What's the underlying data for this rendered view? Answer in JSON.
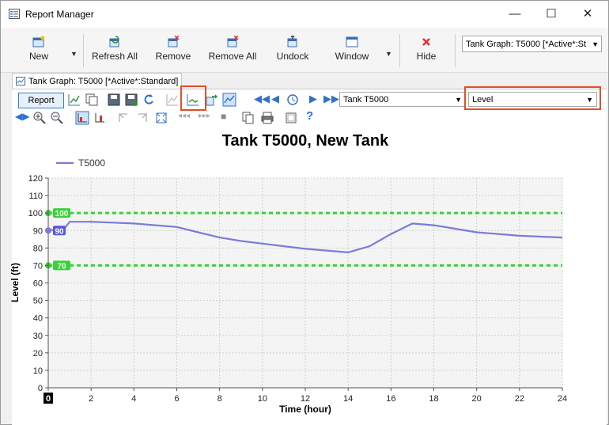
{
  "window": {
    "title": "Report Manager",
    "minimize_glyph": "—",
    "maximize_glyph": "☐",
    "close_glyph": "✕"
  },
  "ribbon": {
    "new": "New",
    "refresh_all": "Refresh All",
    "remove": "Remove",
    "remove_all": "Remove All",
    "undock": "Undock",
    "window": "Window",
    "hide": "Hide",
    "report_selector": "Tank Graph: T5000 [*Active*:St"
  },
  "tab": {
    "label": "Tank Graph: T5000 [*Active*:Standard]"
  },
  "toolbar": {
    "report_label": "Report",
    "element_selector": "Tank T5000",
    "field_selector": "Level",
    "help_glyph": "?"
  },
  "colors": {
    "series": "#7b7bd8",
    "threshold": "#3ad13a",
    "highlight": "#e0502a",
    "accent": "#2f6fd1"
  },
  "chart_data": {
    "type": "line",
    "title": "Tank T5000, New Tank",
    "xlabel": "Time (hour)",
    "ylabel": "Level (ft)",
    "xlim": [
      0,
      24
    ],
    "ylim": [
      0,
      120
    ],
    "xticks": [
      0,
      2,
      4,
      6,
      8,
      10,
      12,
      14,
      16,
      18,
      20,
      22,
      24
    ],
    "yticks": [
      0,
      10,
      20,
      30,
      40,
      50,
      60,
      70,
      80,
      90,
      100,
      110,
      120
    ],
    "grid": true,
    "legend": "top-left",
    "series": [
      {
        "name": "T5000",
        "x": [
          0,
          0.75,
          1,
          2,
          4,
          6,
          7,
          8,
          9,
          10,
          11,
          12,
          13,
          14,
          15,
          16,
          17,
          18,
          19,
          20,
          21,
          22,
          23,
          24
        ],
        "y": [
          90,
          91,
          95,
          95,
          94,
          92,
          89,
          86,
          84,
          82.5,
          81,
          79.5,
          78.5,
          77.5,
          81,
          88,
          94,
          93,
          91,
          89,
          88,
          87,
          86.5,
          86
        ]
      }
    ],
    "thresholds": [
      {
        "value": 100,
        "label": "100"
      },
      {
        "value": 70,
        "label": "70"
      }
    ],
    "start_marker": {
      "value": 90,
      "label": "90"
    },
    "current_time_label": "0"
  }
}
